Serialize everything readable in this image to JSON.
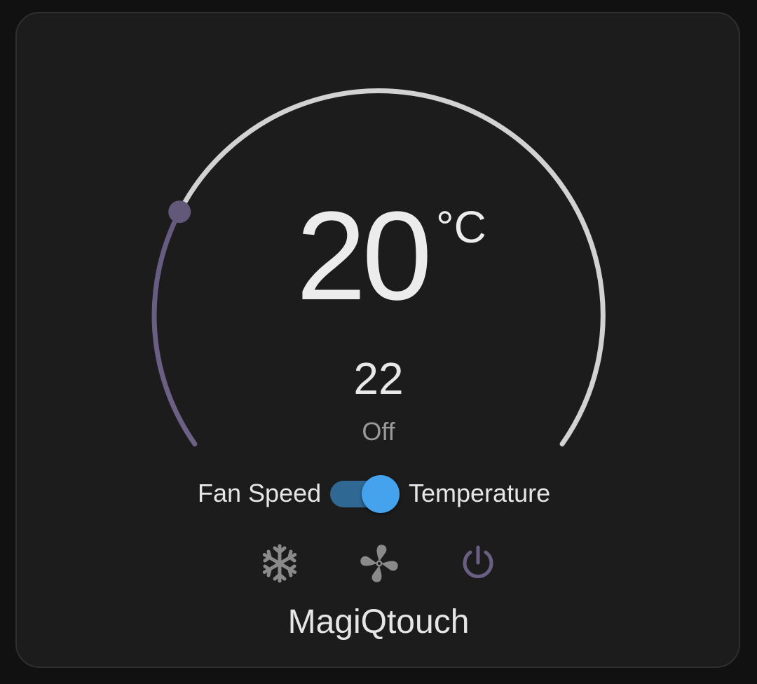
{
  "thermostat": {
    "current_temperature": "20",
    "unit": "°C",
    "target_temperature": "22",
    "hvac_state": "Off",
    "device_name": "MagiQtouch",
    "setpoint_fraction": 0.25
  },
  "mode_toggle": {
    "left_label": "Fan Speed",
    "right_label": "Temperature",
    "selected": "Temperature"
  },
  "hvac_modes": [
    {
      "name": "cool",
      "icon": "snowflake-icon",
      "active": false
    },
    {
      "name": "fan_only",
      "icon": "fan-icon",
      "active": false
    },
    {
      "name": "off",
      "icon": "power-icon",
      "active": true
    }
  ],
  "colors": {
    "background": "#111111",
    "card": "#1c1c1c",
    "dial_active": "#6a5f82",
    "dial_inactive": "#d2d2d2",
    "toggle_track": "#2e6893",
    "toggle_knob": "#45a3ee",
    "icon_inactive": "#8a8a8a",
    "icon_active": "#6a5f82"
  }
}
